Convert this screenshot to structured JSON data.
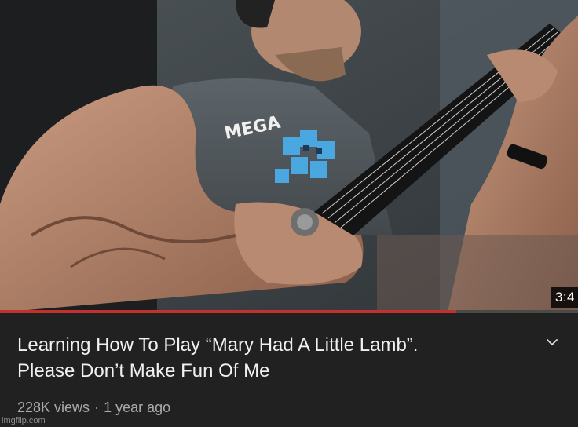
{
  "video": {
    "duration": "3:4",
    "progress_fraction": 0.79,
    "thumbnail_shirt_text": "MEGA",
    "title_line1": "Learning How To Play “Mary Had A Little Lamb”.",
    "title_line2": "Please Don’t Make Fun Of Me",
    "views": "228K views",
    "separator": "·",
    "age": "1 year ago",
    "expand_icon": "chevron-down-icon"
  },
  "watermark": "imgflip.com",
  "colors": {
    "background": "#212121",
    "progress": "#c4302b",
    "title_text": "#f1f1f1",
    "meta_text": "#aaaaaa"
  }
}
